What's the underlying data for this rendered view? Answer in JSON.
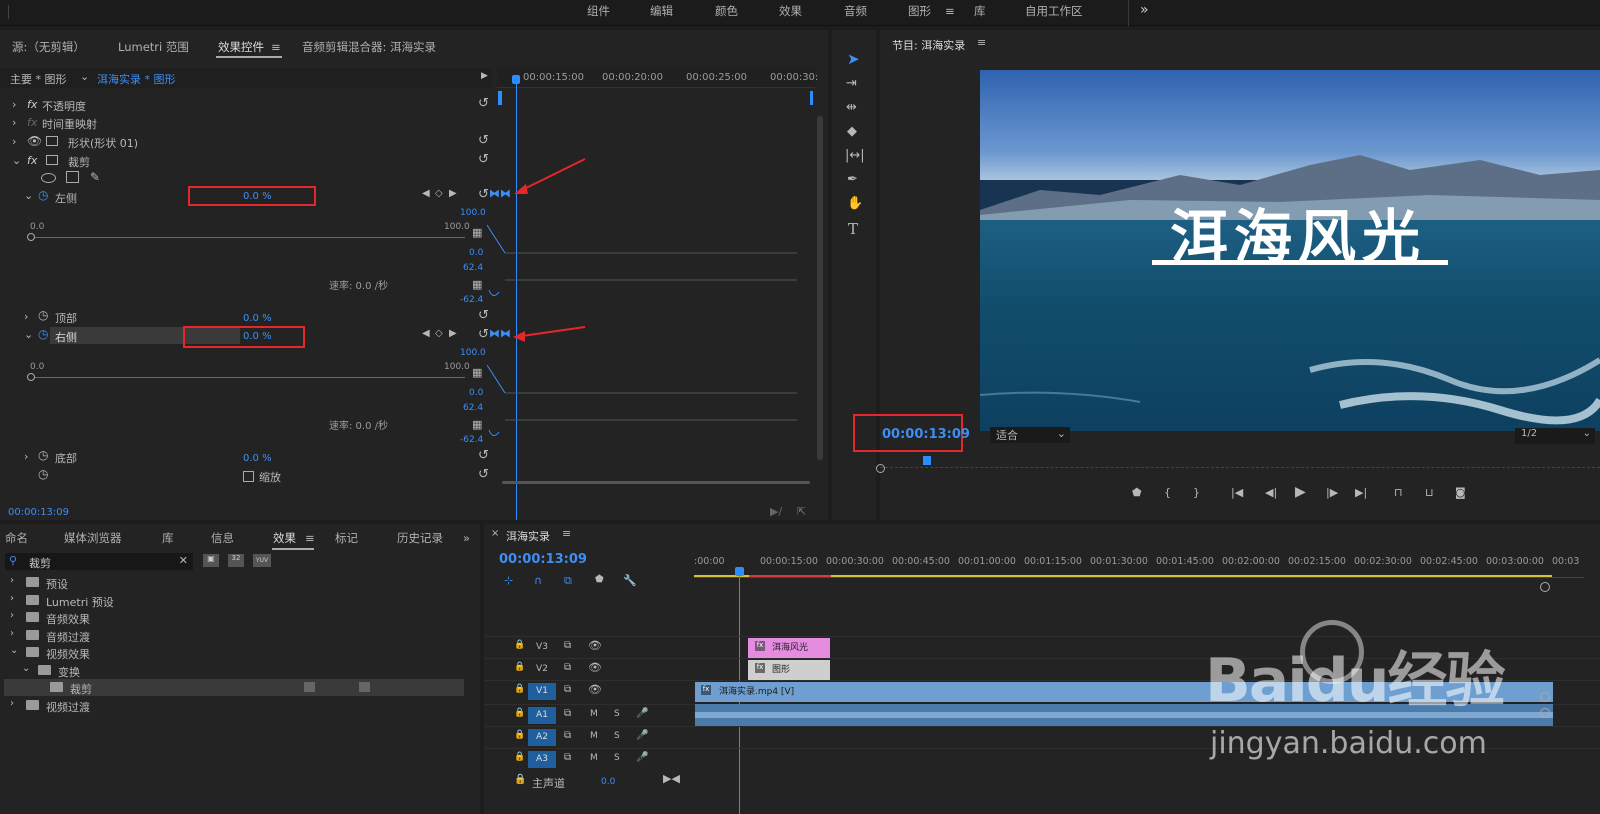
{
  "workspaces": {
    "items": [
      "组件",
      "编辑",
      "颜色",
      "效果",
      "音频",
      "图形",
      "库",
      "自用工作区"
    ],
    "active": "图形",
    "more": "»"
  },
  "source_tabs": {
    "source": "源:（无剪辑）",
    "lumetri": "Lumetri 范围",
    "effect_controls": "效果控件",
    "audio_mixer": "音频剪辑混合器: 洱海实录"
  },
  "ec": {
    "master": "主要 * 图形",
    "clip": "洱海实录 * 图形",
    "ruler": [
      "00:00:15:00",
      "00:00:20:00",
      "00:00:25:00",
      "00:00:30:"
    ],
    "rows": {
      "opacity": "不透明度",
      "time_remap": "时间重映射",
      "shape": "形状(形状 01)",
      "crop": "裁剪",
      "left": "左侧",
      "top": "顶部",
      "right": "右侧",
      "bottom": "底部",
      "zoom": "缩放"
    },
    "values": {
      "left": "0.0 %",
      "top": "0.0 %",
      "right": "0.0 %",
      "bottom": "0.0 %"
    },
    "slider_min": "0.0",
    "slider_max": "100.0",
    "rate": "速率: 0.0 /秒",
    "graph_labels": [
      "100.0",
      "0.0",
      "62.4",
      "-62.4"
    ],
    "timecode": "00:00:13:09"
  },
  "program": {
    "title": "节目: 洱海实录",
    "overlay_title": "洱海风光",
    "timecode": "00:00:13:09",
    "fit": "适合",
    "quality": "1/2"
  },
  "bottom_tabs": {
    "items": [
      "命名",
      "媒体浏览器",
      "库",
      "信息",
      "效果",
      "标记",
      "历史记录"
    ],
    "active": "效果"
  },
  "effects": {
    "search": "裁剪",
    "tree": [
      {
        "label": "预设",
        "indent": 0,
        "expand": "›"
      },
      {
        "label": "Lumetri 预设",
        "indent": 0,
        "expand": "›"
      },
      {
        "label": "音频效果",
        "indent": 0,
        "expand": "›"
      },
      {
        "label": "音频过渡",
        "indent": 0,
        "expand": "›"
      },
      {
        "label": "视频效果",
        "indent": 0,
        "expand": "⌄"
      },
      {
        "label": "变换",
        "indent": 1,
        "expand": "⌄"
      },
      {
        "label": "裁剪",
        "indent": 2,
        "expand": ""
      },
      {
        "label": "视频过渡",
        "indent": 0,
        "expand": "›"
      }
    ],
    "filter_icons": [
      "32",
      "YUV"
    ]
  },
  "timeline": {
    "seq_name": "洱海实录",
    "timecode": "00:00:13:09",
    "ruler": [
      ":00:00",
      "00:00:15:00",
      "00:00:30:00",
      "00:00:45:00",
      "00:01:00:00",
      "00:01:15:00",
      "00:01:30:00",
      "00:01:45:00",
      "00:02:00:00",
      "00:02:15:00",
      "00:02:30:00",
      "00:02:45:00",
      "00:03:00:00",
      "00:03"
    ],
    "tracks": [
      {
        "name": "V3",
        "type": "v"
      },
      {
        "name": "V2",
        "type": "v"
      },
      {
        "name": "V1",
        "type": "v",
        "active": true
      },
      {
        "name": "A1",
        "type": "a"
      },
      {
        "name": "A2",
        "type": "a"
      },
      {
        "name": "A3",
        "type": "a"
      }
    ],
    "master": "主声道",
    "master_val": "0.0",
    "clips": {
      "title": "洱海风光",
      "graphic": "图形",
      "video": "洱海实录.mp4 [V]"
    }
  },
  "watermark": {
    "brand": "Baidu经验",
    "url": "jingyan.baidu.com"
  },
  "colors": {
    "accent": "#2d8cff",
    "red": "#e5262a",
    "pink": "#e58be0",
    "video": "#6f9fd0"
  }
}
